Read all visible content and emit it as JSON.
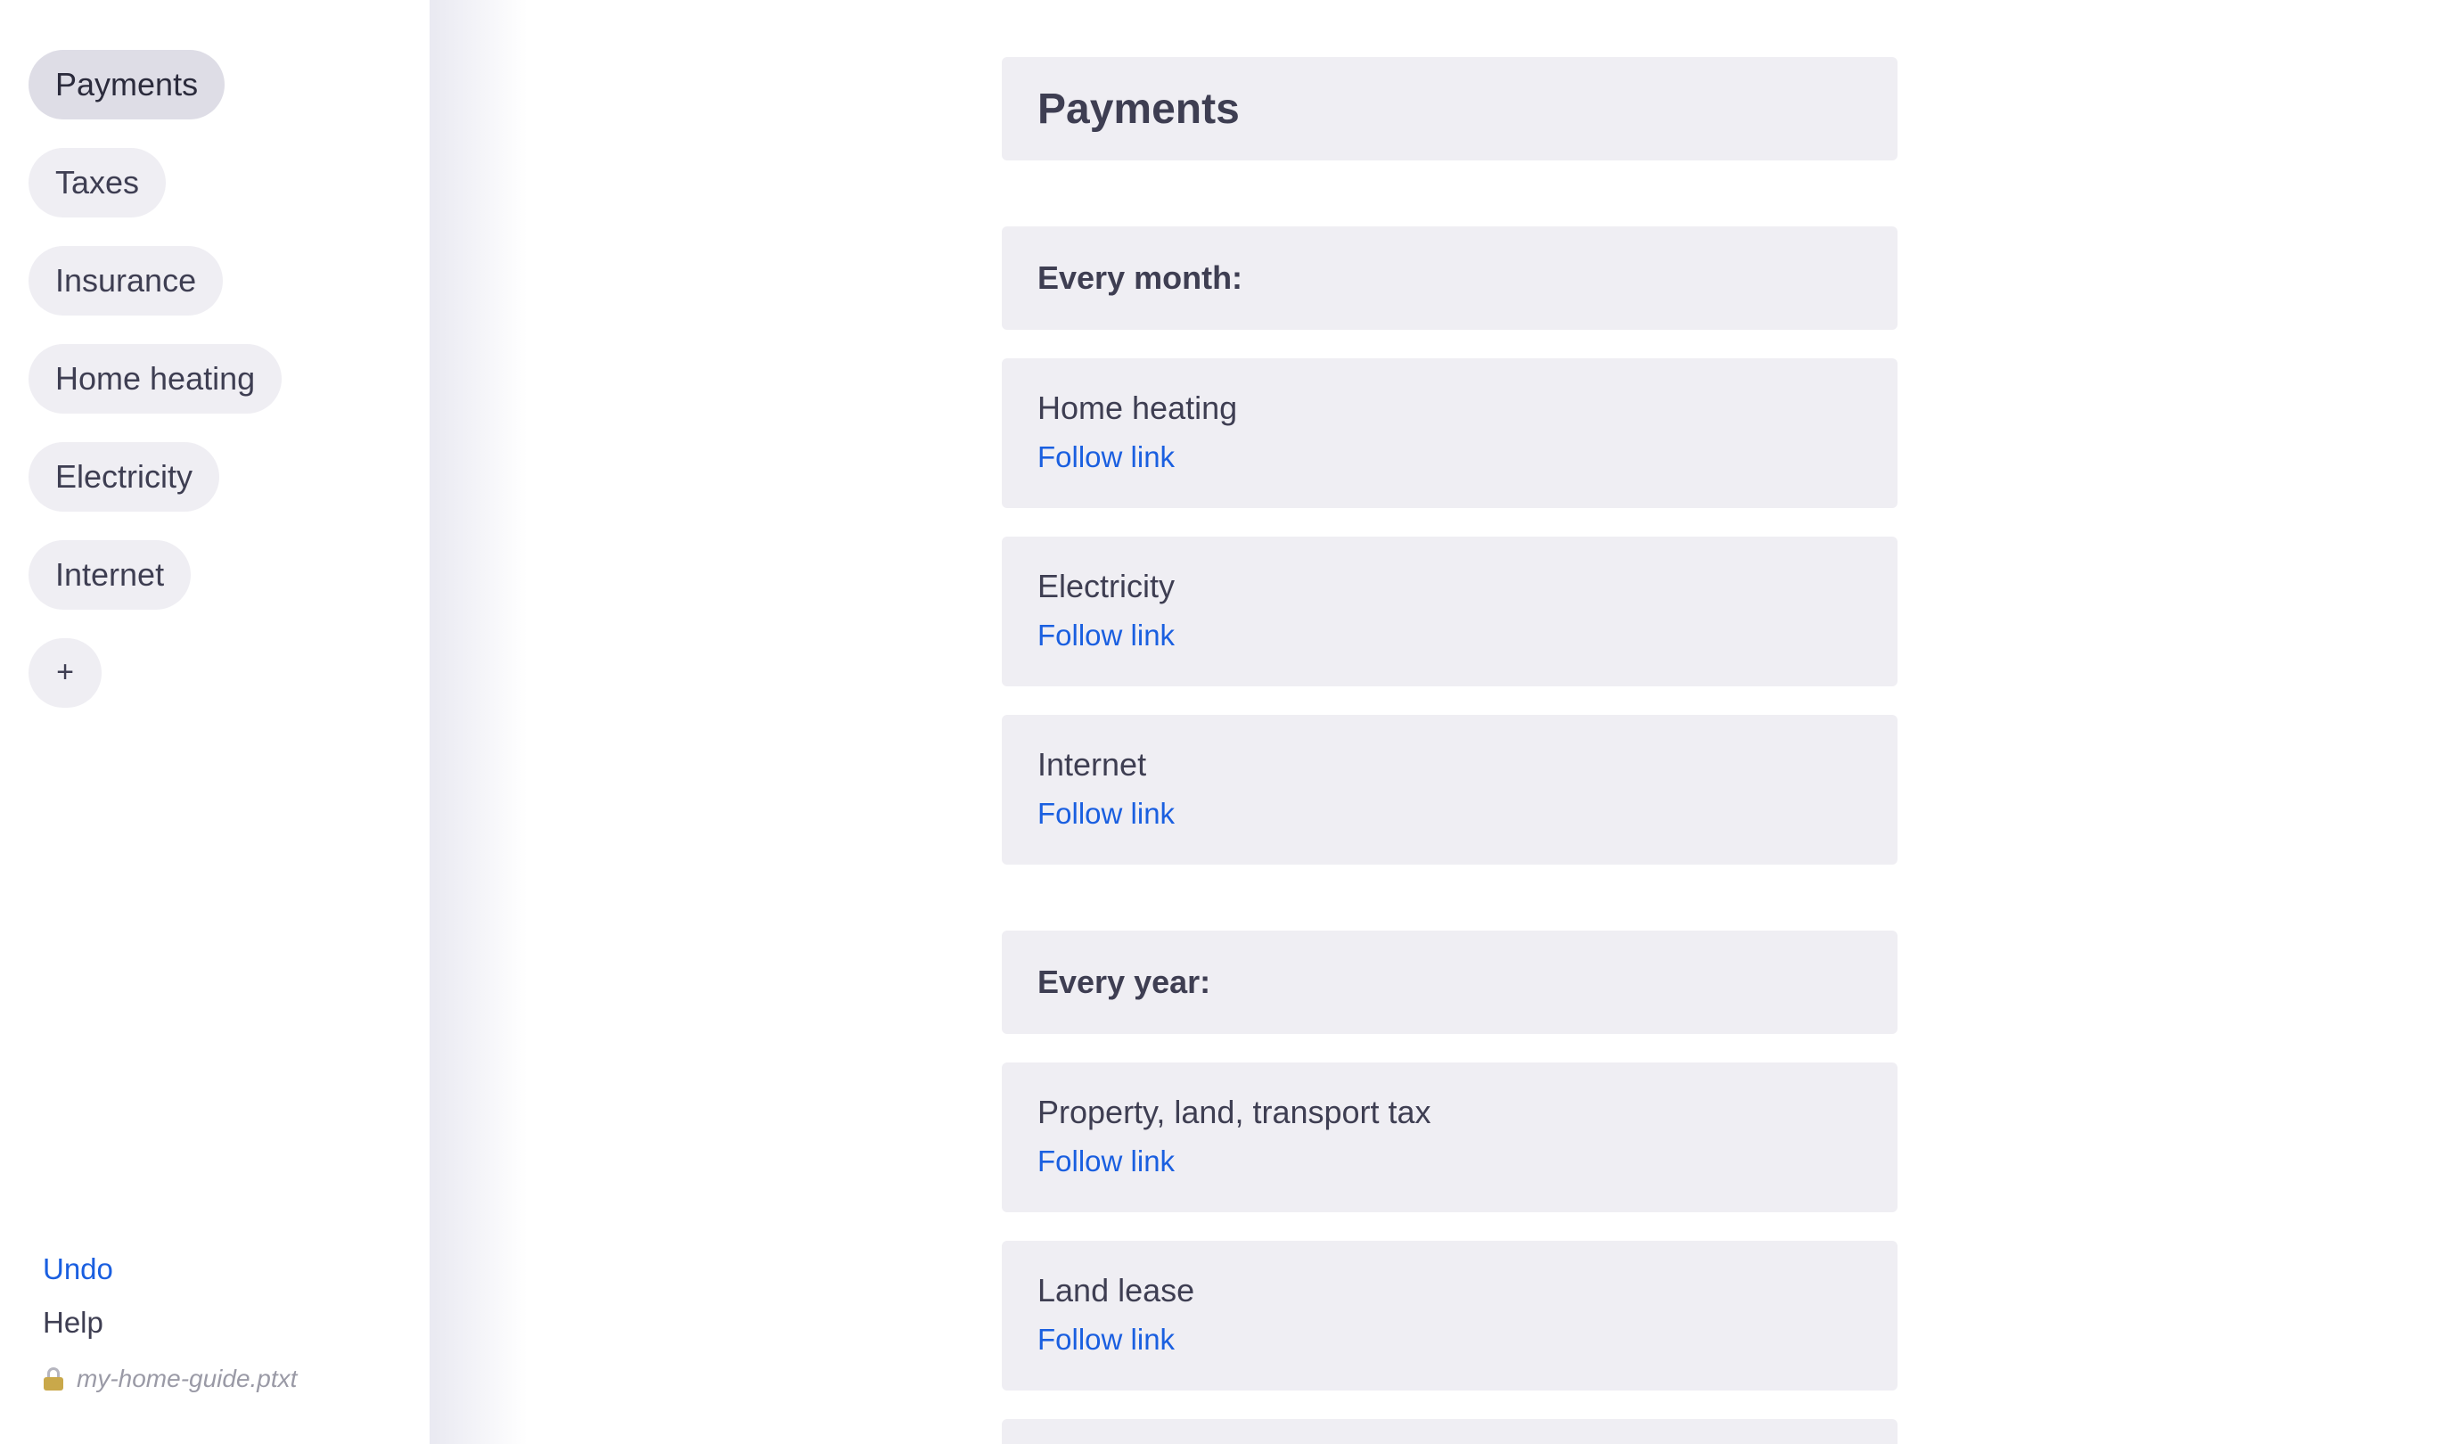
{
  "sidebar": {
    "items": [
      {
        "label": "Payments",
        "active": true
      },
      {
        "label": "Taxes"
      },
      {
        "label": "Insurance"
      },
      {
        "label": "Home heating"
      },
      {
        "label": "Electricity"
      },
      {
        "label": "Internet"
      }
    ],
    "add_label": "+",
    "undo_label": "Undo",
    "help_label": "Help",
    "file_name": "my-home-guide.ptxt",
    "file_icon": "lock-icon"
  },
  "main": {
    "title": "Payments",
    "sections": [
      {
        "title": "Every month:",
        "items": [
          {
            "title": "Home heating",
            "link": "Follow link"
          },
          {
            "title": "Electricity",
            "link": "Follow link"
          },
          {
            "title": "Internet",
            "link": "Follow link"
          }
        ]
      },
      {
        "title": "Every year:",
        "items": [
          {
            "title": "Property, land, transport tax",
            "link": "Follow link"
          },
          {
            "title": "Land lease",
            "link": "Follow link"
          }
        ]
      }
    ]
  },
  "colors": {
    "card_background": "#efeef3",
    "active_nav_background": "#dedde6",
    "link": "#1a5fe0",
    "text": "#3e3e52"
  }
}
